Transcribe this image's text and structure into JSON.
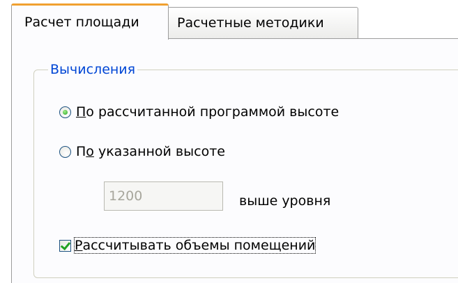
{
  "tabs": [
    {
      "label": "Расчет площади",
      "active": true
    },
    {
      "label": "Расчетные методики",
      "active": false
    }
  ],
  "group": {
    "legend": "Вычисления",
    "radio_computed": {
      "accel": "П",
      "rest": "о рассчитанной программой высоте",
      "checked": true
    },
    "radio_specified": {
      "before": "П",
      "accel": "о",
      "rest": " указанной высоте",
      "checked": false
    },
    "height_input": {
      "value": "1200",
      "disabled": true
    },
    "height_suffix": "выше уровня",
    "checkbox_volumes": {
      "accel": "Р",
      "rest": "ассчитывать объемы помещений",
      "checked": true
    }
  },
  "colors": {
    "legend": "#0046d5",
    "tab_highlight": "#f0a030",
    "check": "#21a121"
  }
}
